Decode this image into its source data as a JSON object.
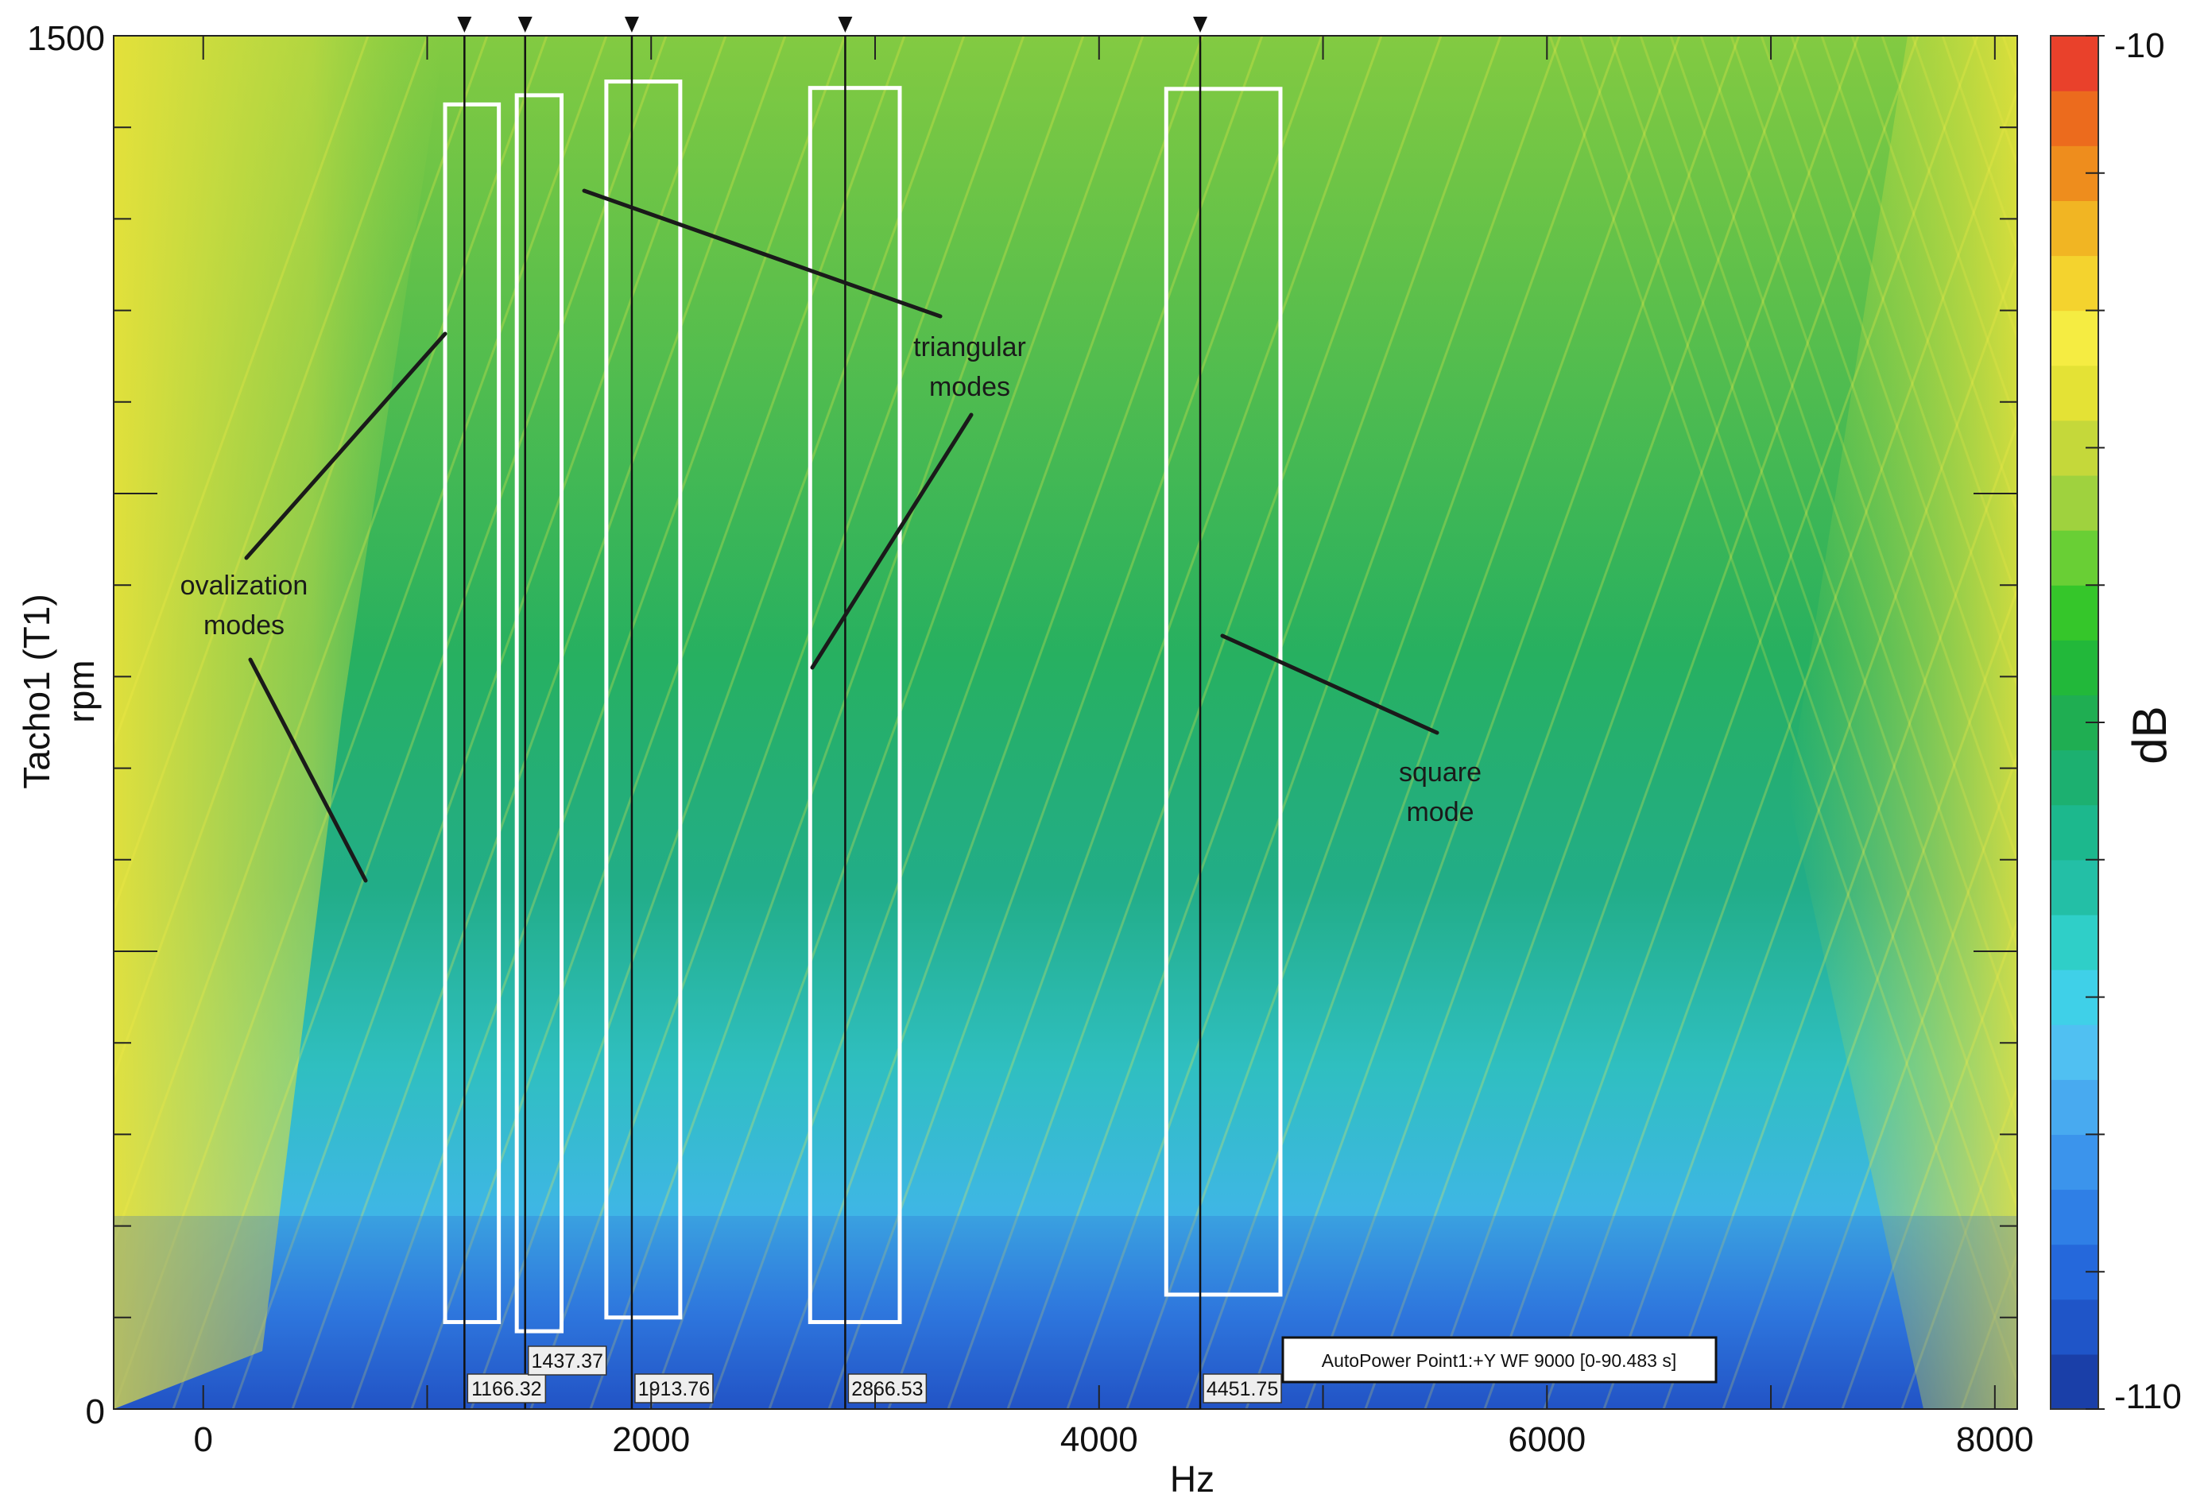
{
  "chart_data": {
    "type": "heatmap",
    "title": "",
    "xlabel": "Hz",
    "ylabel_line1": "Tacho1 (T1)",
    "ylabel_line2": "rpm",
    "xlim": [
      -400,
      8100
    ],
    "ylim": [
      0,
      1500
    ],
    "x_ticks": [
      0,
      2000,
      4000,
      6000,
      8000
    ],
    "y_ticks": [
      0,
      1500
    ],
    "colorbar": {
      "label": "dB",
      "range": [
        -110,
        -10
      ],
      "tick_labels": [
        "-10",
        "-110"
      ],
      "colors": [
        "#1a3fa8",
        "#1f55c8",
        "#2568db",
        "#2f7fe6",
        "#3b94ec",
        "#48aaf0",
        "#50c0f2",
        "#3fd0e8",
        "#2fcfc8",
        "#23bfa6",
        "#1cb88d",
        "#1cb070",
        "#1fae52",
        "#22b83a",
        "#35c62a",
        "#69cf35",
        "#9fd23e",
        "#c5d83a",
        "#e4e235",
        "#f5ec42",
        "#f4d32e",
        "#f1b523",
        "#ee8d1d",
        "#ec6b1d",
        "#e9412b"
      ]
    },
    "cursors": [
      {
        "hz": 1166.32,
        "label": "1166.32"
      },
      {
        "hz": 1437.37,
        "label": "1437.37"
      },
      {
        "hz": 1913.76,
        "label": "1913.76"
      },
      {
        "hz": 2866.53,
        "label": "2866.53"
      },
      {
        "hz": 4451.75,
        "label": "4451.75"
      }
    ],
    "mode_boxes": [
      {
        "x0": 1080,
        "x1": 1320,
        "y0": 95,
        "y1": 1425
      },
      {
        "x0": 1400,
        "x1": 1600,
        "y0": 85,
        "y1": 1435
      },
      {
        "x0": 1800,
        "x1": 2130,
        "y0": 100,
        "y1": 1450
      },
      {
        "x0": 2710,
        "x1": 3110,
        "y0": 95,
        "y1": 1443
      },
      {
        "x0": 4300,
        "x1": 4810,
        "y0": 125,
        "y1": 1442
      }
    ],
    "annotations": [
      {
        "lines": [
          "ovalization",
          "modes"
        ]
      },
      {
        "lines": [
          "triangular",
          "modes"
        ]
      },
      {
        "lines": [
          "square",
          "mode"
        ]
      }
    ],
    "legend": "AutoPower Point1:+Y WF 9000 [0-90.483 s]"
  }
}
